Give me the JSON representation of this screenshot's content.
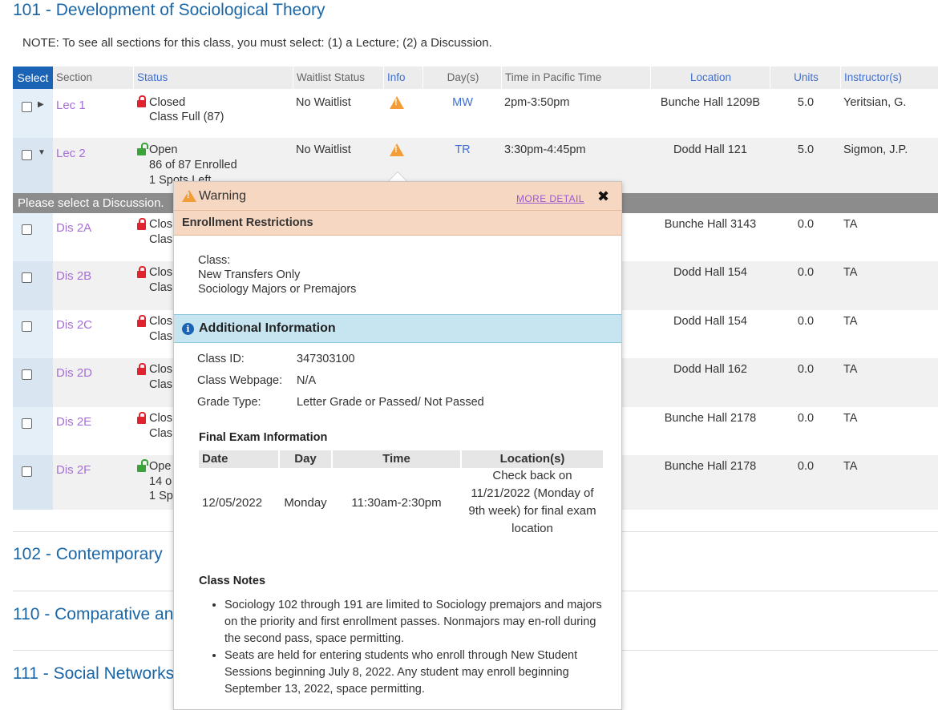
{
  "course": {
    "title": "101 - Development of Sociological Theory",
    "note": "NOTE: To see all sections for this class, you must select: (1) a Lecture; (2) a Discussion."
  },
  "table": {
    "headers": {
      "select": "Select",
      "section": "Section",
      "status": "Status",
      "waitlist": "Waitlist Status",
      "info": "Info",
      "days": "Day(s)",
      "time": "Time in Pacific Time",
      "location": "Location",
      "units": "Units",
      "instructor": "Instructor(s)"
    },
    "lectures": [
      {
        "section": "Lec 1",
        "status": "Closed",
        "status2": "Class Full (87)",
        "status3": "",
        "waitlist": "No Waitlist",
        "days": "MW",
        "time": "2pm-3:50pm",
        "location": "Bunche Hall 1209B",
        "units": "5.0",
        "instructor": "Yeritsian, G."
      },
      {
        "section": "Lec 2",
        "status": "Open",
        "status2": "86 of 87 Enrolled",
        "status3": "1 Spots Left",
        "waitlist": "No Waitlist",
        "days": "TR",
        "time": "3:30pm-4:45pm",
        "location": "Dodd Hall 121",
        "units": "5.0",
        "instructor": "Sigmon, J.P."
      }
    ],
    "discussion_bar": "Please select a Discussion.",
    "discussions": [
      {
        "section": "Dis 2A",
        "status": "Clos",
        "status2": "Clas",
        "location": "Bunche Hall 3143",
        "units": "0.0",
        "instructor": "TA"
      },
      {
        "section": "Dis 2B",
        "status": "Clos",
        "status2": "Clas",
        "location": "Dodd Hall 154",
        "units": "0.0",
        "instructor": "TA"
      },
      {
        "section": "Dis 2C",
        "status": "Clos",
        "status2": "Clas",
        "location": "Dodd Hall 154",
        "units": "0.0",
        "instructor": "TA"
      },
      {
        "section": "Dis 2D",
        "status": "Clos",
        "status2": "Clas",
        "location": "Dodd Hall 162",
        "units": "0.0",
        "instructor": "TA"
      },
      {
        "section": "Dis 2E",
        "status": "Clos",
        "status2": "Clas",
        "location": "Bunche Hall 2178",
        "units": "0.0",
        "instructor": "TA"
      },
      {
        "section": "Dis 2F",
        "status": "Ope",
        "status2": "14 o",
        "status3": "1 Sp",
        "location": "Bunche Hall 2178",
        "units": "0.0",
        "instructor": "TA"
      }
    ]
  },
  "other_courses": [
    "102 - Contemporary",
    "110 - Comparative an",
    "111 - Social Networks"
  ],
  "popover": {
    "warning_title": "Warning",
    "more_detail": "MORE DETAIL",
    "restrictions_title": "Enrollment Restrictions",
    "restrictions_lines": [
      "Class:",
      "New Transfers Only",
      "Sociology Majors or Premajors"
    ],
    "info_title": "Additional Information",
    "class_id_label": "Class ID:",
    "class_id": "347303100",
    "webpage_label": "Class Webpage:",
    "webpage": "N/A",
    "grade_label": "Grade Type:",
    "grade": "Letter Grade or Passed/ Not Passed",
    "exam_title": "Final Exam Information",
    "exam_headers": {
      "date": "Date",
      "day": "Day",
      "time": "Time",
      "location": "Location(s)"
    },
    "exam_row": {
      "date": "12/05/2022",
      "day": "Monday",
      "time": "11:30am-2:30pm",
      "location_lines": [
        "Check back on",
        "11/21/2022 (Monday of",
        "9th week) for final exam",
        "location"
      ]
    },
    "notes_title": "Class Notes",
    "notes": [
      "Sociology 102 through 191 are limited to Sociology premajors and majors on the priority and first enrollment passes. Nonmajors may en-roll during the second pass, space permitting.",
      "Seats are held for entering students who enroll through New Student Sessions beginning July 8, 2022. Any student may enroll beginning September 13, 2022, space permitting."
    ]
  },
  "colors": {
    "accent": "#1b63b5",
    "title": "#1a66a6",
    "section_link": "#a66fd6",
    "closed": "#e0232e",
    "open": "#3ba33a",
    "warning": "#f29d38"
  }
}
